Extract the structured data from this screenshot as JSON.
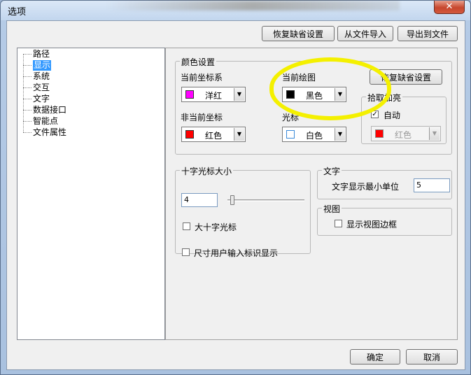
{
  "window": {
    "title": "选项",
    "close_label": "✕"
  },
  "top_buttons": {
    "restore_defaults": "恢复缺省设置",
    "import_file": "从文件导入",
    "export_file": "导出到文件"
  },
  "tree": {
    "items": [
      {
        "label": "路径"
      },
      {
        "label": "显示",
        "selected": true
      },
      {
        "label": "系统"
      },
      {
        "label": "交互"
      },
      {
        "label": "文字"
      },
      {
        "label": "数据接口"
      },
      {
        "label": "智能点"
      },
      {
        "label": "文件属性"
      }
    ]
  },
  "color_settings": {
    "group_title": "颜色设置",
    "current_coord": {
      "label": "当前坐标系",
      "value": "洋红",
      "swatch": "#ff00ff"
    },
    "current_draw": {
      "label": "当前绘图",
      "value": "黑色",
      "swatch": "#000000"
    },
    "non_current_coord": {
      "label": "非当前坐标",
      "value": "红色",
      "swatch": "#ff0000"
    },
    "cursor": {
      "label": "光标",
      "value": "白色",
      "swatch": "#ffffff"
    },
    "restore_button": "恢复缺省设置",
    "pick_highlight": {
      "group_title": "拾取加亮",
      "auto_label": "自动",
      "auto_checked": true,
      "color_value": "红色",
      "swatch": "#ff0000"
    }
  },
  "crosshair": {
    "group_title": "十字光标大小",
    "value": "4",
    "big_label": "大十字光标",
    "big_checked": false
  },
  "text_group": {
    "group_title": "文字",
    "min_unit_label": "文字显示最小单位",
    "min_unit_value": "5"
  },
  "view_group": {
    "group_title": "视图",
    "border_label": "显示视图边框",
    "border_checked": false
  },
  "dimension": {
    "label": "尺寸用户输入标识显示",
    "checked": false
  },
  "bottom_buttons": {
    "ok": "确定",
    "cancel": "取消"
  },
  "colors": {
    "highlight": "#f4f000",
    "selection": "#3399ff"
  }
}
